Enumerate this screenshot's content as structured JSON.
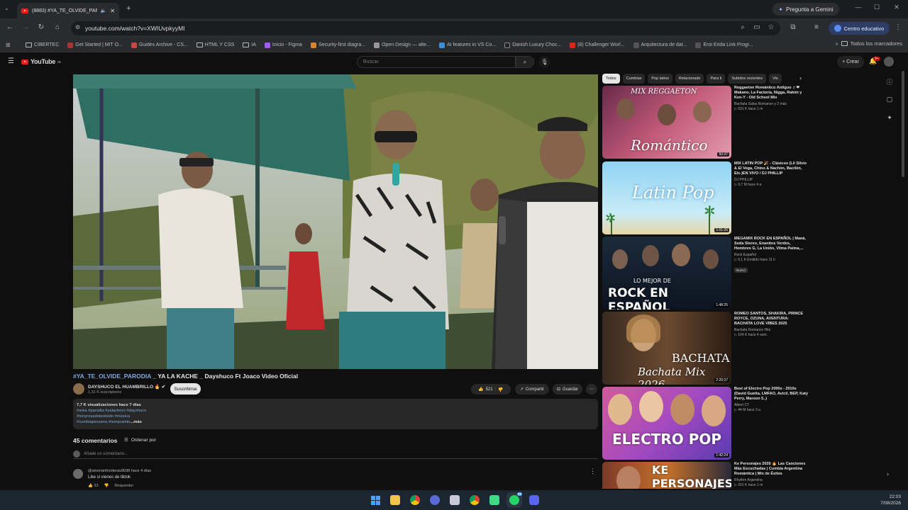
{
  "browser": {
    "tab_title": "(8883) #YA_TE_OLVIDE_PAR",
    "gemini_label": "Pregunta a Gemini",
    "url": "youtube.com/watch?v=XWIUvpkyyMI",
    "profile_label": "Centro educativo",
    "bookmarks": [
      "CIBERTEC",
      "Get Started | MIT O...",
      "Guides Archive - CS...",
      "HTML Y CSS",
      "IA",
      "Inicio - Figma",
      "Security-first diagra...",
      "Open Design — alte...",
      "AI features in VS Co...",
      "Danish Luxury Choc...",
      "(8) Challenger Worl...",
      "Arquitectura de dat...",
      "Eroi Erida Link Progr..."
    ],
    "all_bookmarks": "Todos los marcadores"
  },
  "youtube": {
    "logo": "YouTube",
    "logo_country": "PE",
    "search_placeholder": "Buscar",
    "create_label": "Crear",
    "notif_count": "9+"
  },
  "video": {
    "title_tag": "#YA_TE_OLVIDE_PARODIA",
    "title_rest": " _ YA LA KACHE _ Dayshuco Ft Joaco Video Oficial",
    "channel": "DAYSHUCO EL HUAMBRILLO 🔥 ✔",
    "subs": "1,31 K suscriptores",
    "subscribe": "Suscribirse",
    "likes": "521",
    "share": "Compartir",
    "save": "Guardar",
    "desc_stats": "7,7 K visualizaciones  hace 7 días",
    "desc_tags": [
      "#arka #parodia #yalachero #dayshuco",
      "#tonyrosadoteolvido #música",
      "#cumbiaperuana #tempranito"
    ],
    "desc_more": "...más"
  },
  "comments": {
    "count": "45 comentarios",
    "sort": "Ordenar por",
    "add_placeholder": "Añade un comentario...",
    "items": [
      {
        "author": "@amorsinfronteras9038  hace 4 días",
        "text": "Like si vienes de tiktok",
        "likes": "33",
        "reply": "Responder"
      }
    ]
  },
  "sidebar": {
    "chips": [
      "Todos",
      "Cumbias",
      "Pop latino",
      "Relacionado",
      "Para ti",
      "Subidos recientes",
      "Vis"
    ],
    "recommendations": [
      {
        "title": "Reggaeton Romántico Antiguo ♬❤ Makano, La Factoría, Nigga, Rakim y Ken-Y - Old School Mix",
        "channel": "Bachata Salsa Romance y 2 más",
        "meta": "▷ 531 K  hace 1 m",
        "badge": "",
        "duration": "50:37",
        "thumb_text": "Romántico",
        "thumb_top": "MIX REGGAETON"
      },
      {
        "title": "MIX LATIN POP 🎉 - Clásicos (Lil Silvio & El Vega, Chino & Nachón, Bacilón, Etc.)EN VIVO / DJ PHILLIP",
        "channel": "DJ PHILLIP",
        "meta": "▷ 9,7 M  hace 4 a",
        "badge": "",
        "duration": "1:01:26",
        "thumb_text": "Latin Pop",
        "thumb_top": ""
      },
      {
        "title": "MEGAMIX ROCK EN ESPAÑOL | Maná, Soda Stereo, Enanitos Verdes, Hombres G, La Unión, Vilma Palma,...",
        "channel": "Rock Español",
        "meta": "▷ 6,1 K  Emitido hace 11 h",
        "badge": "Nuevo",
        "duration": "1:48:25",
        "thumb_text": "ROCK EN ESPAÑOL",
        "thumb_top": "LO MEJOR DE"
      },
      {
        "title": "ROMEO SANTOS, SHAKIRA, PRINCE ROYCE, OZUNA, AVENTURA: BACHATA LOVE VIBES 2025",
        "channel": "Bachata Romance Hits",
        "meta": "▷ 104 K  hace 4 sem.",
        "badge": "",
        "duration": "2:20:37",
        "thumb_text": "Bachata Mix 2026",
        "thumb_top": "BACHATA"
      },
      {
        "title": "Best of Electro Pop 2000s - 2010s (David Guetta, LMFAO, Avicii, BEP, Katy Perry, Maroon 5..)",
        "channel": "Albert CT",
        "meta": "▷ 44 M  hace 3 a",
        "badge": "",
        "duration": "1:42:24",
        "thumb_text": "ELECTRO POP",
        "thumb_top": ""
      },
      {
        "title": "Ke Personajes 2026 🔥 Las Canciones Más Escuchadas | Cumbia Argentina Romántica | Mix de Éxitos",
        "channel": "Rhythm Argentina",
        "meta": "▷ 201 K  hace 1 m",
        "badge": "",
        "duration": "",
        "thumb_text": "KE PERSONAJES",
        "thumb_top": ""
      }
    ]
  },
  "taskbar": {
    "time": "22:03",
    "date": "7/08/2026",
    "whatsapp_badge": "69"
  },
  "colors": {
    "background": "#0f0f0f",
    "accent_red": "#e62117",
    "link_blue": "#7fa7d6",
    "taskbar": "#1c2630"
  }
}
